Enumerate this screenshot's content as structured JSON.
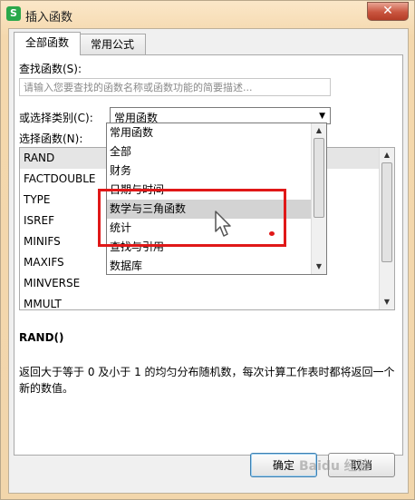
{
  "window": {
    "title": "插入函数",
    "app_icon": "S",
    "close": "✕"
  },
  "tabs": [
    {
      "label": "全部函数"
    },
    {
      "label": "常用公式"
    }
  ],
  "search": {
    "label": "查找函数(S):",
    "placeholder": "请输入您要查找的函数名称或函数功能的简要描述..."
  },
  "category": {
    "label": "或选择类别(C):",
    "selected": "常用函数"
  },
  "function_list": {
    "label": "选择函数(N):",
    "items": [
      "RAND",
      "FACTDOUBLE",
      "TYPE",
      "ISREF",
      "MINIFS",
      "MAXIFS",
      "MINVERSE",
      "MMULT"
    ]
  },
  "category_options": [
    "常用函数",
    "全部",
    "财务",
    "日期与时间",
    "数学与三角函数",
    "统计",
    "查找与引用",
    "数据库"
  ],
  "selected_function": {
    "name": "RAND()",
    "description": "返回大于等于 0 及小于 1 的均匀分布随机数，每次计算工作表时都将返回一个新的数值。"
  },
  "buttons": {
    "ok": "确定",
    "cancel": "取消"
  },
  "watermark": "Baidu 经验"
}
